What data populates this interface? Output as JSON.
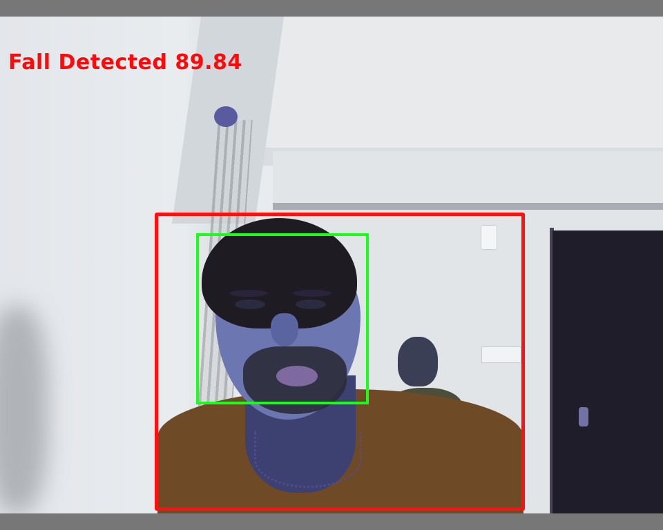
{
  "overlay": {
    "status_text": "Fall Detected 89.84",
    "status_color": "#ff0a0a"
  },
  "detections": {
    "fall_box_color": "#ff1010",
    "face_box_color": "#19ff19"
  }
}
